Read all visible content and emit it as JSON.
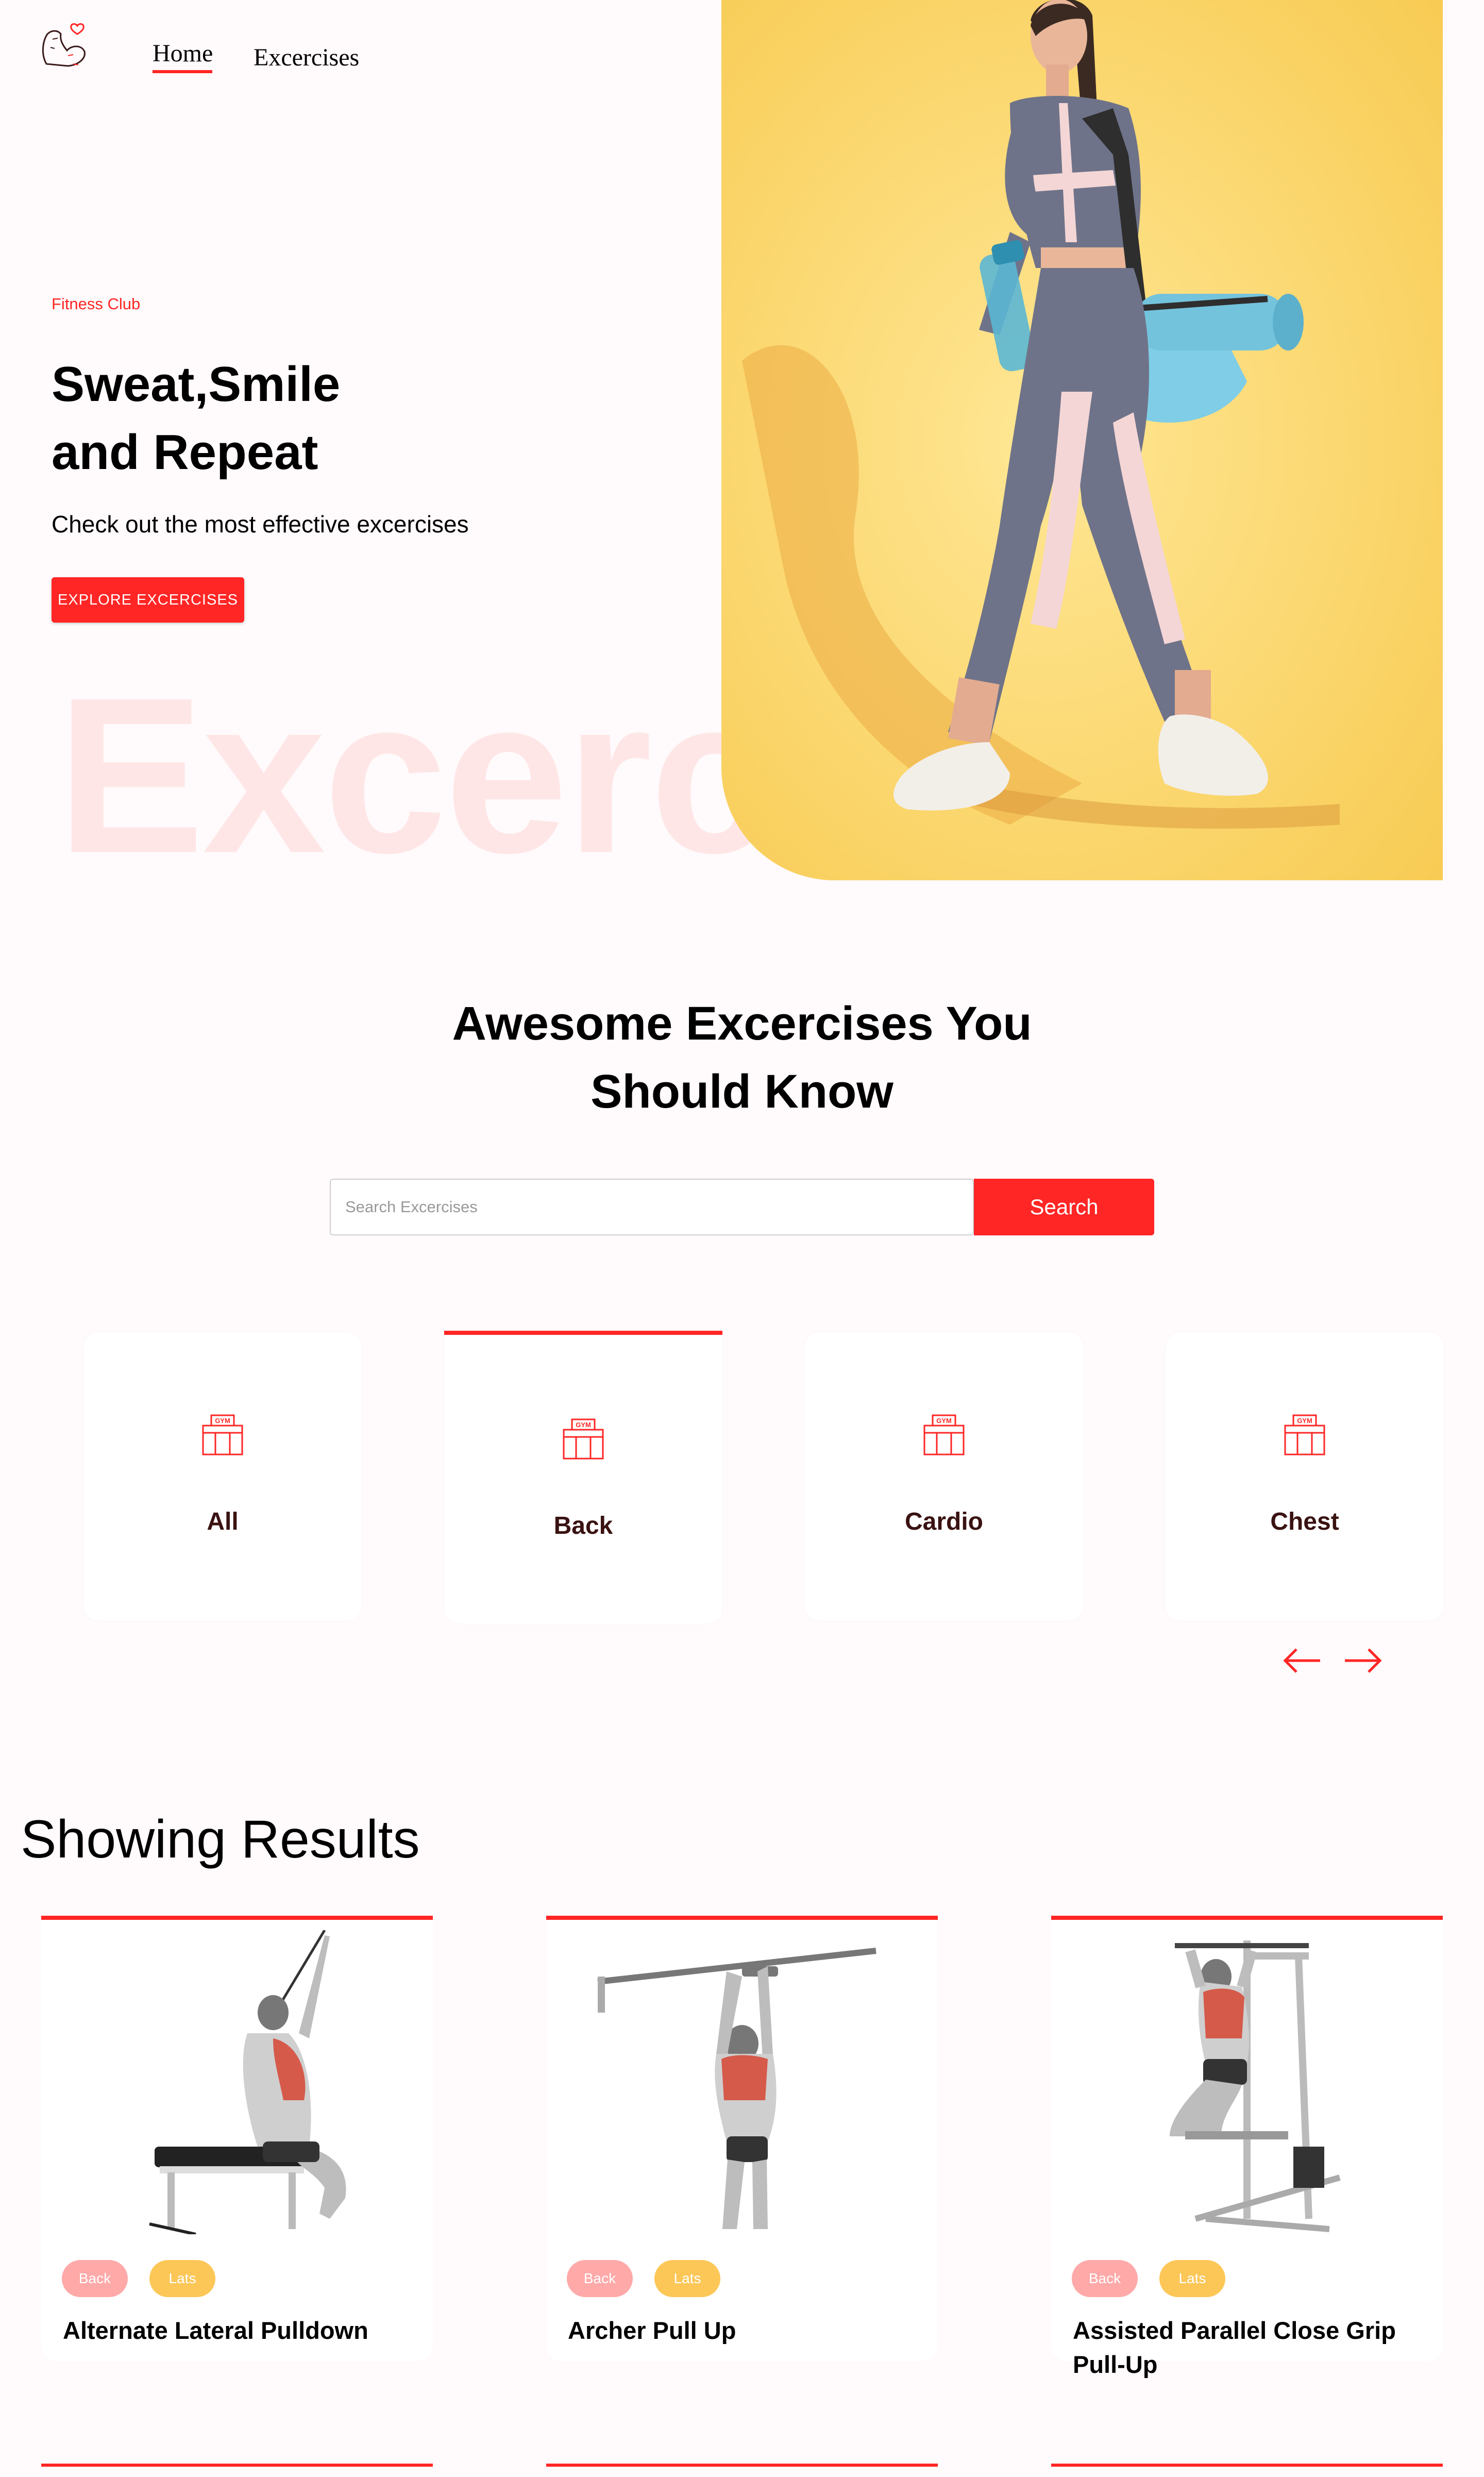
{
  "nav": {
    "logo_icon": "flexed-arm-heart-icon",
    "home_label": "Home",
    "exercises_label": "Excercises"
  },
  "hero": {
    "tag": "Fitness Club",
    "title_line1": "Sweat,Smile",
    "title_line2": "and Repeat",
    "subtitle": "Check out the most effective excercises",
    "button_label": "EXPLORE EXCERCISES",
    "background_word": "Excerc",
    "image_subject": "woman walking with gym bag and water bottle"
  },
  "search": {
    "title_line1": "Awesome Excercises You",
    "title_line2": "Should Know",
    "placeholder": "Search Excercises",
    "button_label": "Search"
  },
  "categories": {
    "items": [
      {
        "label": "All",
        "icon": "gym-icon",
        "active": false
      },
      {
        "label": "Back",
        "icon": "gym-icon",
        "active": true
      },
      {
        "label": "Cardio",
        "icon": "gym-icon",
        "active": false
      },
      {
        "label": "Chest",
        "icon": "gym-icon",
        "active": false
      }
    ],
    "prev_icon": "arrow-left-icon",
    "next_icon": "arrow-right-icon"
  },
  "results": {
    "title": "Showing Results",
    "items": [
      {
        "name": "Alternate Lateral Pulldown",
        "body_part": "Back",
        "target": "Lats",
        "image": "seated-pulldown-illustration"
      },
      {
        "name": "Archer Pull Up",
        "body_part": "Back",
        "target": "Lats",
        "image": "pull-up-illustration"
      },
      {
        "name": "Assisted Parallel Close Grip Pull-Up",
        "body_part": "Back",
        "target": "Lats",
        "image": "assisted-pull-up-machine-illustration"
      }
    ]
  },
  "colors": {
    "accent": "#ff2625",
    "background": "#fffafb",
    "tag_body": "#ffa9a9",
    "tag_target": "#fcc757",
    "hero_image_bg": "#fddd6e"
  }
}
